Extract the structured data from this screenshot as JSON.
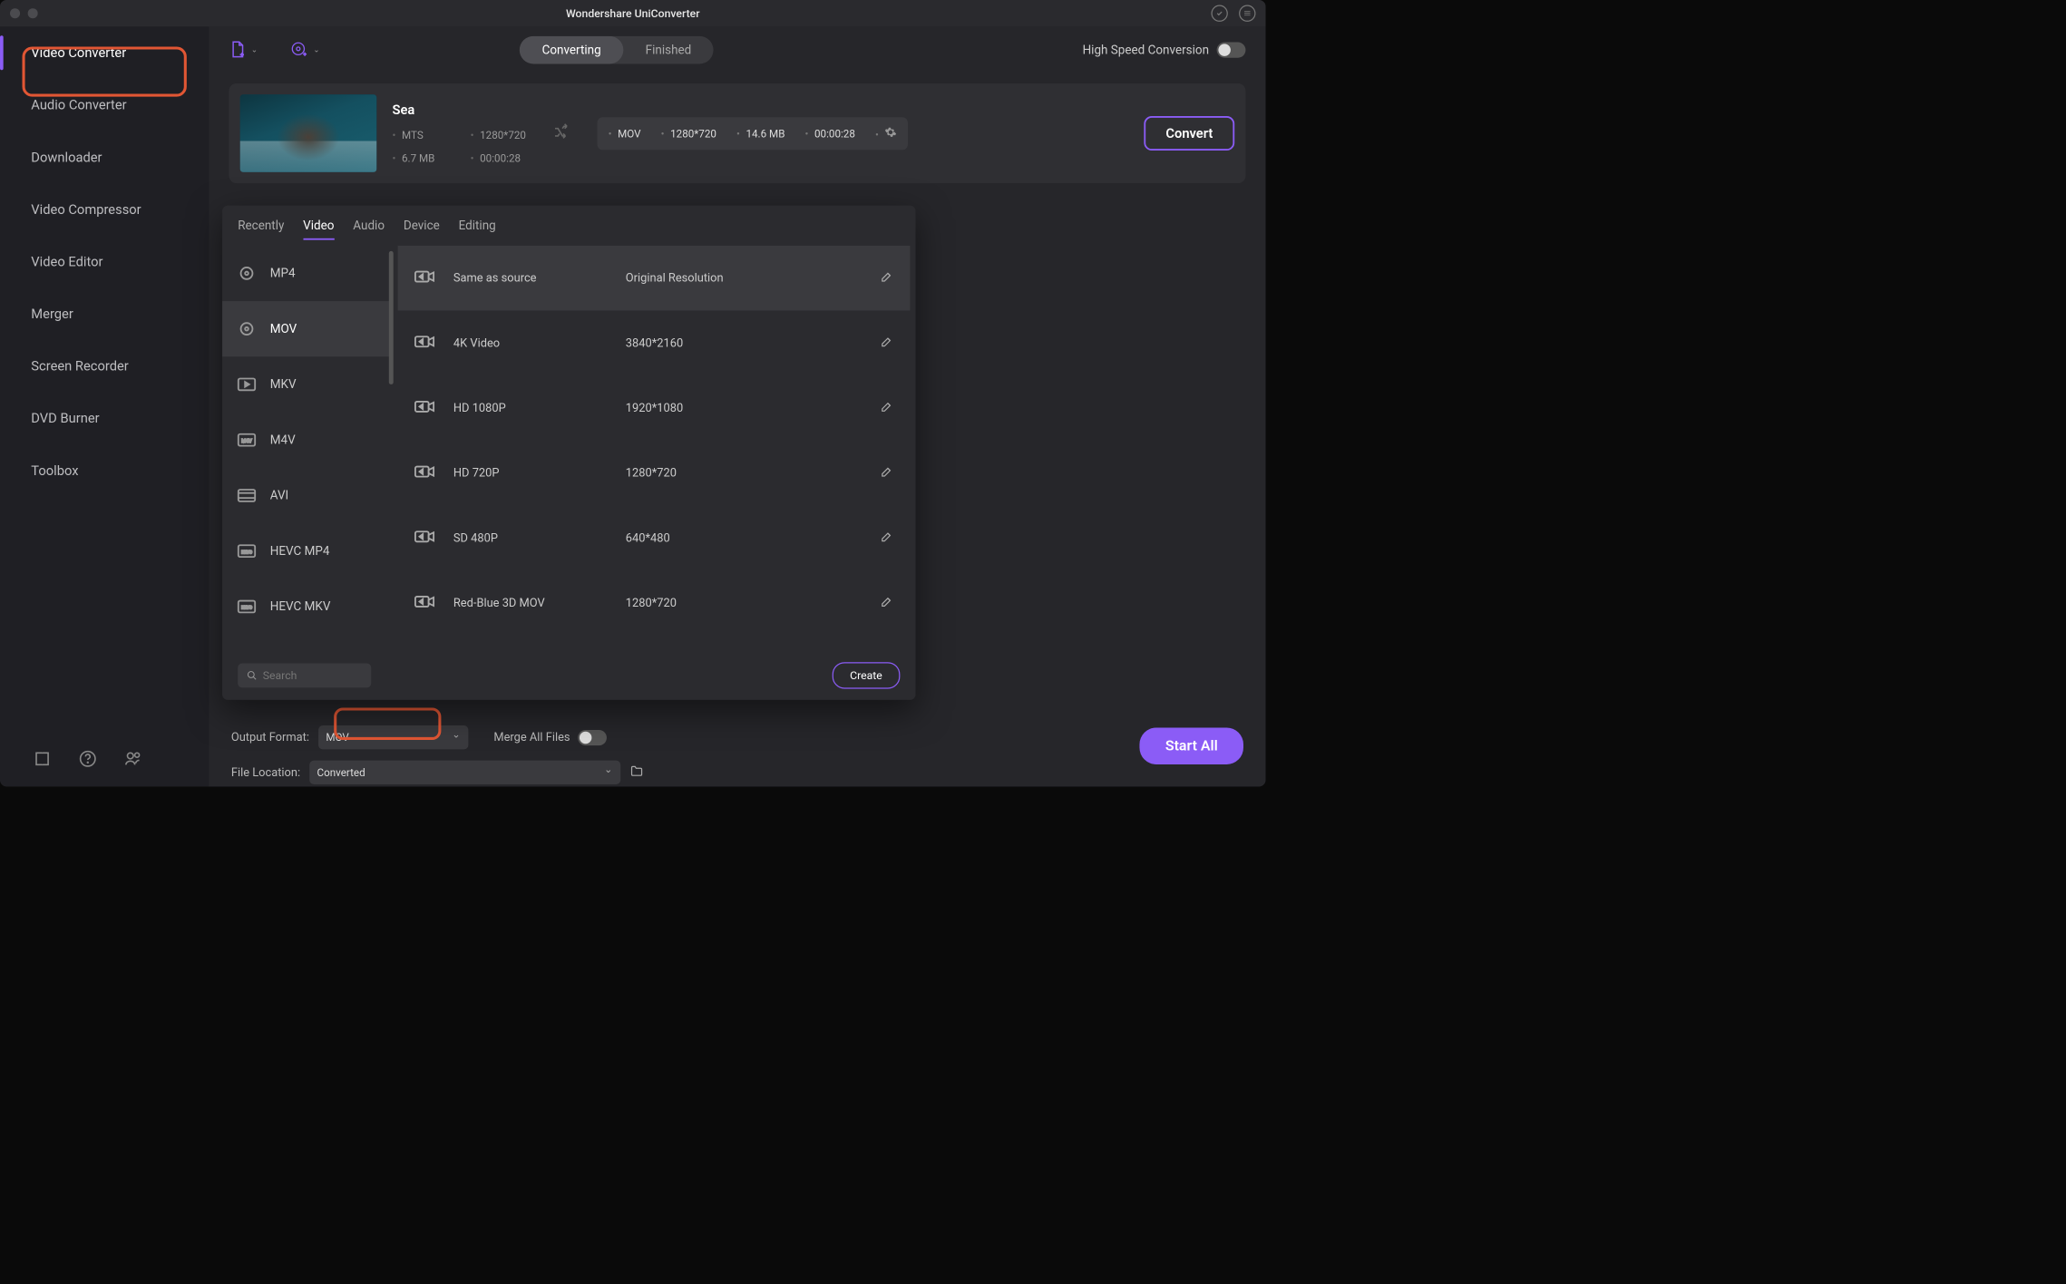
{
  "title": "Wondershare UniConverter",
  "sidebar": {
    "items": [
      {
        "label": "Video Converter"
      },
      {
        "label": "Audio Converter"
      },
      {
        "label": "Downloader"
      },
      {
        "label": "Video Compressor"
      },
      {
        "label": "Video Editor"
      },
      {
        "label": "Merger"
      },
      {
        "label": "Screen Recorder"
      },
      {
        "label": "DVD Burner"
      },
      {
        "label": "Toolbox"
      }
    ]
  },
  "toolbar": {
    "tabs": {
      "converting": "Converting",
      "finished": "Finished"
    },
    "hispeed_label": "High Speed Conversion"
  },
  "file": {
    "name": "Sea",
    "src": {
      "format": "MTS",
      "res": "1280*720",
      "size": "6.7 MB",
      "duration": "00:00:28"
    },
    "out": {
      "format": "MOV",
      "res": "1280*720",
      "size": "14.6 MB",
      "duration": "00:00:28"
    },
    "convert_label": "Convert"
  },
  "format_panel": {
    "tabs": [
      "Recently",
      "Video",
      "Audio",
      "Device",
      "Editing"
    ],
    "active_tab": "Video",
    "left": [
      "MP4",
      "MOV",
      "MKV",
      "M4V",
      "AVI",
      "HEVC MP4",
      "HEVC MKV"
    ],
    "active_left": "MOV",
    "presets": [
      {
        "name": "Same as source",
        "res": "Original Resolution"
      },
      {
        "name": "4K Video",
        "res": "3840*2160"
      },
      {
        "name": "HD 1080P",
        "res": "1920*1080"
      },
      {
        "name": "HD 720P",
        "res": "1280*720"
      },
      {
        "name": "SD 480P",
        "res": "640*480"
      },
      {
        "name": "Red-Blue 3D MOV",
        "res": "1280*720"
      }
    ],
    "search_placeholder": "Search",
    "create_label": "Create"
  },
  "bottom": {
    "output_format_label": "Output Format:",
    "output_format_value": "MOV",
    "file_location_label": "File Location:",
    "file_location_value": "Converted",
    "merge_label": "Merge All Files",
    "start_all_label": "Start All"
  }
}
